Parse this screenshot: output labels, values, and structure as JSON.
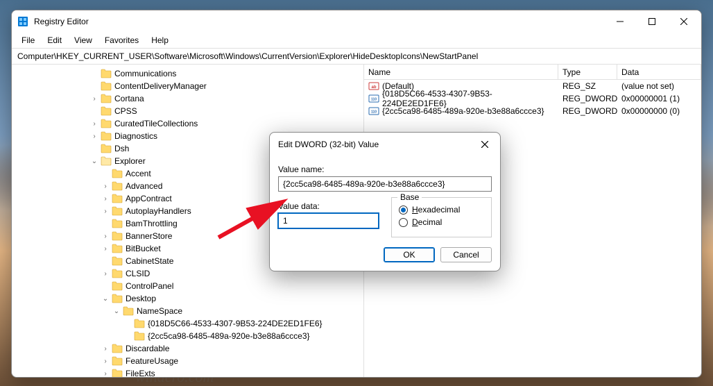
{
  "window": {
    "title": "Registry Editor",
    "menus": [
      "File",
      "Edit",
      "View",
      "Favorites",
      "Help"
    ],
    "address": "Computer\\HKEY_CURRENT_USER\\Software\\Microsoft\\Windows\\CurrentVersion\\Explorer\\HideDesktopIcons\\NewStartPanel"
  },
  "tree": [
    {
      "indent": 7,
      "exp": "",
      "label": "Communications"
    },
    {
      "indent": 7,
      "exp": "",
      "label": "ContentDeliveryManager"
    },
    {
      "indent": 7,
      "exp": ">",
      "label": "Cortana"
    },
    {
      "indent": 7,
      "exp": "",
      "label": "CPSS"
    },
    {
      "indent": 7,
      "exp": ">",
      "label": "CuratedTileCollections"
    },
    {
      "indent": 7,
      "exp": ">",
      "label": "Diagnostics"
    },
    {
      "indent": 7,
      "exp": "",
      "label": "Dsh"
    },
    {
      "indent": 7,
      "exp": "v",
      "label": "Explorer",
      "open": true
    },
    {
      "indent": 8,
      "exp": "",
      "label": "Accent"
    },
    {
      "indent": 8,
      "exp": ">",
      "label": "Advanced"
    },
    {
      "indent": 8,
      "exp": ">",
      "label": "AppContract"
    },
    {
      "indent": 8,
      "exp": ">",
      "label": "AutoplayHandlers"
    },
    {
      "indent": 8,
      "exp": "",
      "label": "BamThrottling"
    },
    {
      "indent": 8,
      "exp": ">",
      "label": "BannerStore"
    },
    {
      "indent": 8,
      "exp": ">",
      "label": "BitBucket"
    },
    {
      "indent": 8,
      "exp": "",
      "label": "CabinetState"
    },
    {
      "indent": 8,
      "exp": ">",
      "label": "CLSID"
    },
    {
      "indent": 8,
      "exp": "",
      "label": "ControlPanel"
    },
    {
      "indent": 8,
      "exp": "v",
      "label": "Desktop"
    },
    {
      "indent": 9,
      "exp": "v",
      "label": "NameSpace"
    },
    {
      "indent": 10,
      "exp": "",
      "label": "{018D5C66-4533-4307-9B53-224DE2ED1FE6}"
    },
    {
      "indent": 10,
      "exp": "",
      "label": "{2cc5ca98-6485-489a-920e-b3e88a6ccce3}"
    },
    {
      "indent": 8,
      "exp": ">",
      "label": "Discardable"
    },
    {
      "indent": 8,
      "exp": ">",
      "label": "FeatureUsage"
    },
    {
      "indent": 8,
      "exp": ">",
      "label": "FileExts"
    }
  ],
  "list": {
    "headers": {
      "name": "Name",
      "type": "Type",
      "data": "Data"
    },
    "rows": [
      {
        "icon": "sz",
        "name": "(Default)",
        "type": "REG_SZ",
        "data": "(value not set)"
      },
      {
        "icon": "dw",
        "name": "{018D5C66-4533-4307-9B53-224DE2ED1FE6}",
        "type": "REG_DWORD",
        "data": "0x00000001 (1)"
      },
      {
        "icon": "dw",
        "name": "{2cc5ca98-6485-489a-920e-b3e88a6ccce3}",
        "type": "REG_DWORD",
        "data": "0x00000000 (0)"
      }
    ]
  },
  "dialog": {
    "title": "Edit DWORD (32-bit) Value",
    "value_name_label": "Value name:",
    "value_name": "{2cc5ca98-6485-489a-920e-b3e88a6ccce3}",
    "value_data_label": "Value data:",
    "value_data": "1",
    "base_label": "Base",
    "hex": "Hexadecimal",
    "dec": "Decimal",
    "ok": "OK",
    "cancel": "Cancel"
  }
}
